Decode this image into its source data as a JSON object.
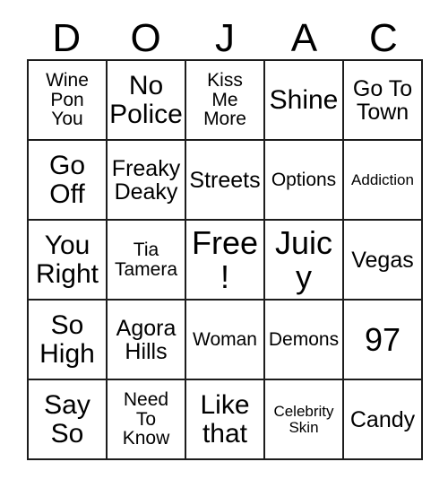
{
  "card": {
    "title_letters": [
      "D",
      "O",
      "J",
      "A",
      "C"
    ],
    "columns": 5,
    "rows": 5,
    "border_color": "#1c1c1c",
    "background_color": "#ffffff",
    "text_color": "#000000",
    "free_space_label": "Free!",
    "cells": [
      [
        {
          "text": "Wine\nPon\nYou",
          "size": "fs-sm"
        },
        {
          "text": "No\nPolice",
          "size": "fs-lg"
        },
        {
          "text": "Kiss\nMe\nMore",
          "size": "fs-sm"
        },
        {
          "text": "Shine",
          "size": "fs-lg"
        },
        {
          "text": "Go To\nTown",
          "size": "fs-md"
        }
      ],
      [
        {
          "text": "Go\nOff",
          "size": "fs-lg"
        },
        {
          "text": "Freaky\nDeaky",
          "size": "fs-md"
        },
        {
          "text": "Streets",
          "size": "fs-md"
        },
        {
          "text": "Options",
          "size": "fs-sm"
        },
        {
          "text": "Addiction",
          "size": "fs-xs"
        }
      ],
      [
        {
          "text": "You\nRight",
          "size": "fs-lg"
        },
        {
          "text": "Tia\nTamera",
          "size": "fs-sm"
        },
        {
          "text": "Free!",
          "size": "fs-xl"
        },
        {
          "text": "Juicy",
          "size": "fs-xl"
        },
        {
          "text": "Vegas",
          "size": "fs-md"
        }
      ],
      [
        {
          "text": "So\nHigh",
          "size": "fs-lg"
        },
        {
          "text": "Agora\nHills",
          "size": "fs-md"
        },
        {
          "text": "Woman",
          "size": "fs-sm"
        },
        {
          "text": "Demons",
          "size": "fs-sm"
        },
        {
          "text": "97",
          "size": "fs-xl"
        }
      ],
      [
        {
          "text": "Say\nSo",
          "size": "fs-lg"
        },
        {
          "text": "Need\nTo\nKnow",
          "size": "fs-sm"
        },
        {
          "text": "Like\nthat",
          "size": "fs-lg"
        },
        {
          "text": "Celebrity\nSkin",
          "size": "fs-xs"
        },
        {
          "text": "Candy",
          "size": "fs-md"
        }
      ]
    ]
  }
}
